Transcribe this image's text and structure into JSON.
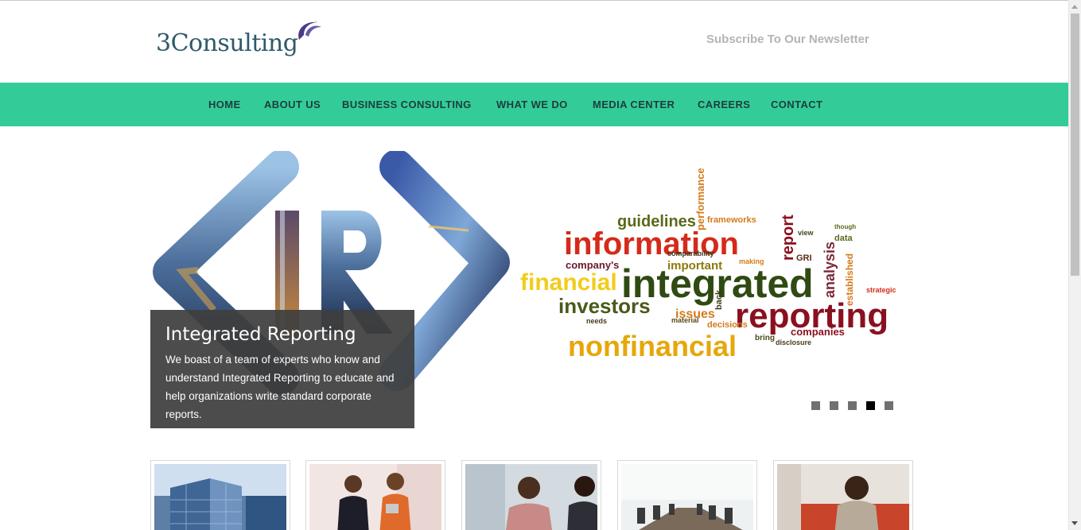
{
  "header": {
    "logo_text": "3Consulting",
    "subscribe_label": "Subscribe To Our Newsletter"
  },
  "nav": {
    "items": [
      {
        "label": "HOME"
      },
      {
        "label": "ABOUT US"
      },
      {
        "label": "BUSINESS CONSULTING"
      },
      {
        "label": "WHAT WE DO"
      },
      {
        "label": "MEDIA CENTER"
      },
      {
        "label": "CAREERS"
      },
      {
        "label": "CONTACT"
      }
    ]
  },
  "slider": {
    "caption_title": "Integrated Reporting",
    "caption_text": "We boast of a team of experts who know and understand Integrated Reporting to educate and help organizations write standard corporate reports.",
    "logo_letters": "IR",
    "word_cloud": [
      "information",
      "integrated",
      "reporting",
      "financial",
      "nonfinancial",
      "investors",
      "guidelines",
      "companies",
      "report",
      "analysis",
      "important",
      "issues",
      "frameworks",
      "performance",
      "established",
      "strategic",
      "decisions",
      "material",
      "view",
      "data",
      "GRI",
      "disclosure",
      "bring",
      "company's"
    ],
    "active_slide": 4,
    "slide_count": 5
  },
  "colors": {
    "nav_background": "#33cc99",
    "nav_text": "#1e3d3a",
    "logo_text": "#2e5a6b",
    "subscribe_text": "#b4b4b4",
    "caption_background": "#3e3e3e"
  }
}
